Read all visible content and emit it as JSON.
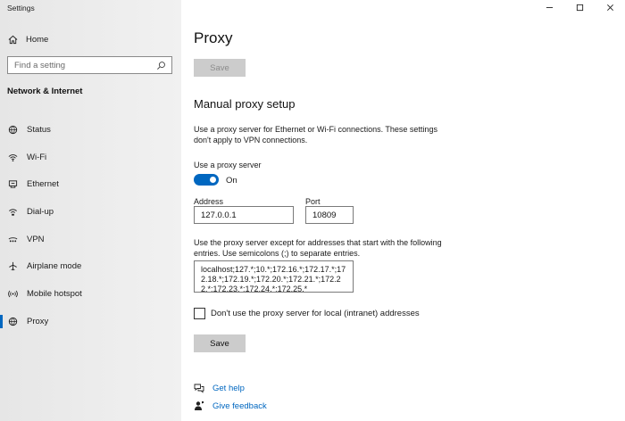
{
  "window": {
    "title": "Settings"
  },
  "sidebar": {
    "home_label": "Home",
    "search_placeholder": "Find a setting",
    "section_title": "Network & Internet",
    "items": [
      {
        "label": "Status",
        "icon": "globe-status-icon"
      },
      {
        "label": "Wi-Fi",
        "icon": "wifi-icon"
      },
      {
        "label": "Ethernet",
        "icon": "ethernet-icon"
      },
      {
        "label": "Dial-up",
        "icon": "dialup-icon"
      },
      {
        "label": "VPN",
        "icon": "vpn-icon"
      },
      {
        "label": "Airplane mode",
        "icon": "airplane-icon"
      },
      {
        "label": "Mobile hotspot",
        "icon": "hotspot-icon"
      },
      {
        "label": "Proxy",
        "icon": "globe-icon",
        "active": true
      }
    ]
  },
  "main": {
    "page_title": "Proxy",
    "save_top_label": "Save",
    "manual_title": "Manual proxy setup",
    "manual_desc": "Use a proxy server for Ethernet or Wi-Fi connections. These settings don't apply to VPN connections.",
    "use_proxy_label": "Use a proxy server",
    "toggle_state": "On",
    "address_label": "Address",
    "address_value": "127.0.0.1",
    "port_label": "Port",
    "port_value": "10809",
    "exceptions_desc": "Use the proxy server except for addresses that start with the following entries. Use semicolons (;) to separate entries.",
    "exceptions_value": "localhost;127.*;10.*;172.16.*;172.17.*;172.18.*;172.19.*;172.20.*;172.21.*;172.22.*;172.23.*;172.24.*;172.25.*",
    "local_checkbox_label": "Don't use the proxy server for local (intranet) addresses",
    "local_checkbox_checked": false,
    "save_label": "Save",
    "get_help": "Get help",
    "give_feedback": "Give feedback"
  },
  "colors": {
    "accent": "#0067c0",
    "sidebar_bg": "#ececec",
    "button_bg": "#cccccc"
  }
}
